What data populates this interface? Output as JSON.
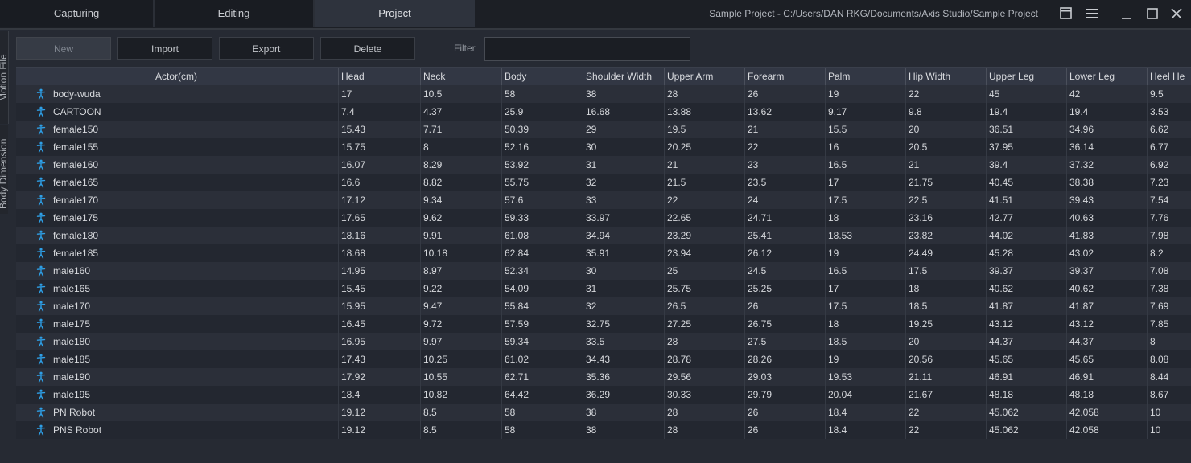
{
  "tabs": [
    {
      "label": "Capturing",
      "active": false
    },
    {
      "label": "Editing",
      "active": false
    },
    {
      "label": "Project",
      "active": true
    }
  ],
  "window_title": "Sample Project - C:/Users/DAN RKG/Documents/Axis Studio/Sample Project",
  "side_tabs": [
    "Motion File",
    "Body Dimension"
  ],
  "toolbar": {
    "new": "New",
    "import": "Import",
    "export": "Export",
    "delete": "Delete",
    "filter_label": "Filter",
    "filter_value": ""
  },
  "colors": {
    "accent_icon": "#2e9fe6",
    "header_bg": "#323744",
    "row_even": "#2b2f39",
    "row_odd": "#232730"
  },
  "table": {
    "columns": [
      "Actor(cm)",
      "Head",
      "Neck",
      "Body",
      "Shoulder Width",
      "Upper Arm",
      "Forearm",
      "Palm",
      "Hip Width",
      "Upper Leg",
      "Lower Leg",
      "Heel He"
    ],
    "row_icon": "person-icon",
    "rows": [
      [
        "body-wuda",
        "17",
        "10.5",
        "58",
        "38",
        "28",
        "26",
        "19",
        "22",
        "45",
        "42",
        "9.5"
      ],
      [
        "CARTOON",
        "7.4",
        "4.37",
        "25.9",
        "16.68",
        "13.88",
        "13.62",
        "9.17",
        "9.8",
        "19.4",
        "19.4",
        "3.53"
      ],
      [
        "female150",
        "15.43",
        "7.71",
        "50.39",
        "29",
        "19.5",
        "21",
        "15.5",
        "20",
        "36.51",
        "34.96",
        "6.62"
      ],
      [
        "female155",
        "15.75",
        "8",
        "52.16",
        "30",
        "20.25",
        "22",
        "16",
        "20.5",
        "37.95",
        "36.14",
        "6.77"
      ],
      [
        "female160",
        "16.07",
        "8.29",
        "53.92",
        "31",
        "21",
        "23",
        "16.5",
        "21",
        "39.4",
        "37.32",
        "6.92"
      ],
      [
        "female165",
        "16.6",
        "8.82",
        "55.75",
        "32",
        "21.5",
        "23.5",
        "17",
        "21.75",
        "40.45",
        "38.38",
        "7.23"
      ],
      [
        "female170",
        "17.12",
        "9.34",
        "57.6",
        "33",
        "22",
        "24",
        "17.5",
        "22.5",
        "41.51",
        "39.43",
        "7.54"
      ],
      [
        "female175",
        "17.65",
        "9.62",
        "59.33",
        "33.97",
        "22.65",
        "24.71",
        "18",
        "23.16",
        "42.77",
        "40.63",
        "7.76"
      ],
      [
        "female180",
        "18.16",
        "9.91",
        "61.08",
        "34.94",
        "23.29",
        "25.41",
        "18.53",
        "23.82",
        "44.02",
        "41.83",
        "7.98"
      ],
      [
        "female185",
        "18.68",
        "10.18",
        "62.84",
        "35.91",
        "23.94",
        "26.12",
        "19",
        "24.49",
        "45.28",
        "43.02",
        "8.2"
      ],
      [
        "male160",
        "14.95",
        "8.97",
        "52.34",
        "30",
        "25",
        "24.5",
        "16.5",
        "17.5",
        "39.37",
        "39.37",
        "7.08"
      ],
      [
        "male165",
        "15.45",
        "9.22",
        "54.09",
        "31",
        "25.75",
        "25.25",
        "17",
        "18",
        "40.62",
        "40.62",
        "7.38"
      ],
      [
        "male170",
        "15.95",
        "9.47",
        "55.84",
        "32",
        "26.5",
        "26",
        "17.5",
        "18.5",
        "41.87",
        "41.87",
        "7.69"
      ],
      [
        "male175",
        "16.45",
        "9.72",
        "57.59",
        "32.75",
        "27.25",
        "26.75",
        "18",
        "19.25",
        "43.12",
        "43.12",
        "7.85"
      ],
      [
        "male180",
        "16.95",
        "9.97",
        "59.34",
        "33.5",
        "28",
        "27.5",
        "18.5",
        "20",
        "44.37",
        "44.37",
        "8"
      ],
      [
        "male185",
        "17.43",
        "10.25",
        "61.02",
        "34.43",
        "28.78",
        "28.26",
        "19",
        "20.56",
        "45.65",
        "45.65",
        "8.08"
      ],
      [
        "male190",
        "17.92",
        "10.55",
        "62.71",
        "35.36",
        "29.56",
        "29.03",
        "19.53",
        "21.11",
        "46.91",
        "46.91",
        "8.44"
      ],
      [
        "male195",
        "18.4",
        "10.82",
        "64.42",
        "36.29",
        "30.33",
        "29.79",
        "20.04",
        "21.67",
        "48.18",
        "48.18",
        "8.67"
      ],
      [
        "PN Robot",
        "19.12",
        "8.5",
        "58",
        "38",
        "28",
        "26",
        "18.4",
        "22",
        "45.062",
        "42.058",
        "10"
      ],
      [
        "PNS Robot",
        "19.12",
        "8.5",
        "58",
        "38",
        "28",
        "26",
        "18.4",
        "22",
        "45.062",
        "42.058",
        "10"
      ]
    ]
  }
}
